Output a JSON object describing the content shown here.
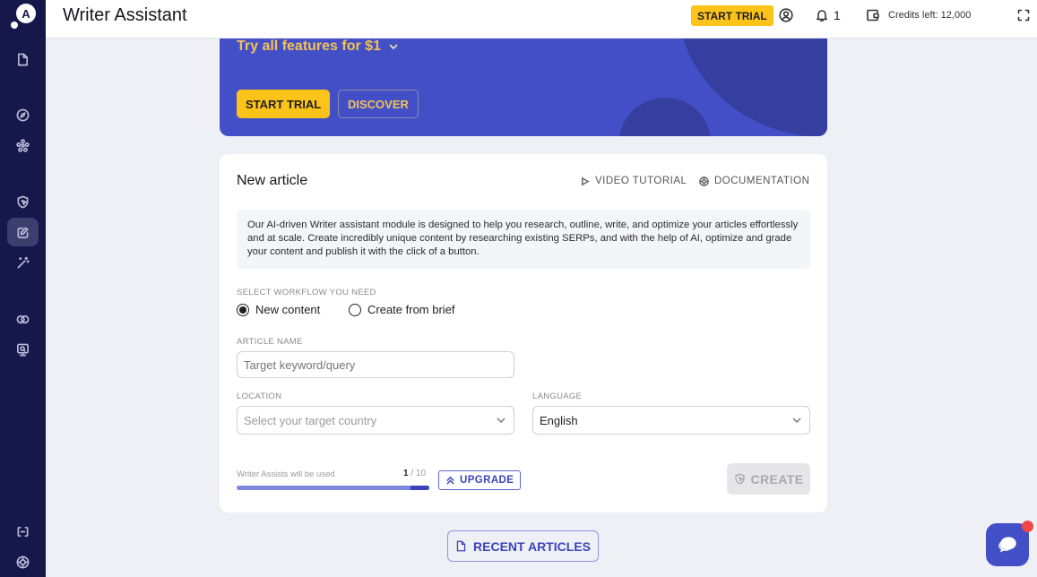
{
  "app": {
    "title": "Writer Assistant"
  },
  "topbar": {
    "start_trial": "START TRIAL",
    "notifications_count": "1",
    "credits": "Credits left: 12,000"
  },
  "sidebar": {
    "items": [
      {
        "name": "documents",
        "icon": "file-icon"
      },
      {
        "name": "explore",
        "icon": "compass-icon"
      },
      {
        "name": "clusters",
        "icon": "cluster-icon"
      },
      {
        "name": "optimize",
        "icon": "shield-cursor-icon"
      },
      {
        "name": "writer",
        "icon": "edit-icon",
        "active": true
      },
      {
        "name": "ai-magic",
        "icon": "magic-wand-icon"
      },
      {
        "name": "compare",
        "icon": "overlap-circles-icon"
      },
      {
        "name": "monitor",
        "icon": "monitor-search-icon"
      },
      {
        "name": "integrations",
        "icon": "code-brackets-icon"
      },
      {
        "name": "help",
        "icon": "lifebuoy-icon"
      }
    ]
  },
  "banner": {
    "title": "Try all features for $1",
    "start_trial": "START TRIAL",
    "discover": "DISCOVER"
  },
  "card": {
    "title": "New article",
    "video_tutorial": "VIDEO TUTORIAL",
    "documentation": "DOCUMENTATION",
    "description": "Our AI-driven Writer assistant module is designed to help you research, outline, write, and optimize your articles effortlessly and at scale. Create incredibly unique content by researching existing SERPs, and with the help of AI, optimize and grade your content and publish it with the click of a button.",
    "workflow_label": "SELECT WORKFLOW YOU NEED",
    "workflow_options": [
      {
        "label": "New content",
        "selected": true
      },
      {
        "label": "Create from brief",
        "selected": false
      }
    ],
    "article_name_label": "ARTICLE NAME",
    "article_name_placeholder": "Target keyword/query",
    "article_name_value": "",
    "location_label": "LOCATION",
    "location_placeholder": "Select your target country",
    "language_label": "LANGUAGE",
    "language_value": "English",
    "assists_label": "Writer Assists will be used",
    "assists_used": "1",
    "assists_total": "/ 10",
    "assists_fraction": 0.1,
    "upgrade": "UPGRADE",
    "create": "CREATE"
  },
  "recent_articles": "RECENT ARTICLES",
  "colors": {
    "sidebar": "#16174a",
    "accent": "#434fc6",
    "trial_yellow": "#fcc419",
    "chat_badge": "#f04646"
  }
}
